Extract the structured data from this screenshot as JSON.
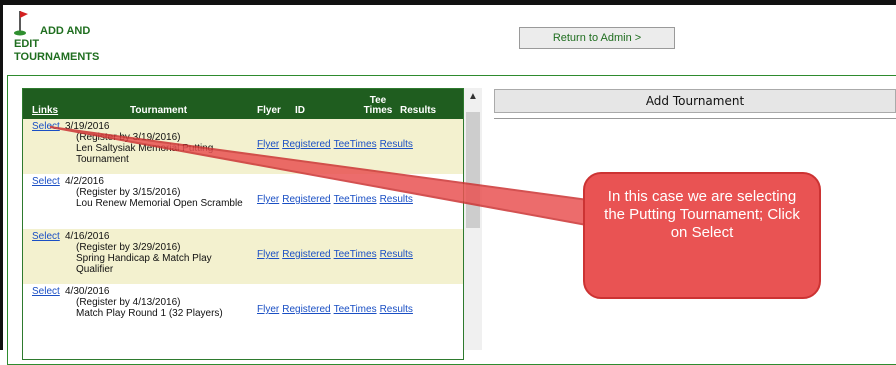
{
  "header": {
    "title_line1": "ADD AND",
    "title_line2": "EDIT",
    "title_line3": "TOURNAMENTS"
  },
  "return_button": "Return to Admin >",
  "add_button": "Add Tournament",
  "table": {
    "headers": {
      "links": "Links",
      "tournament": "Tournament",
      "flyer": "Flyer",
      "id": "ID",
      "tee_line1": "Tee",
      "tee_line2": "Times",
      "results": "Results"
    },
    "rows": [
      {
        "select": "Select",
        "date": "3/19/2016",
        "register": "(Register by 3/19/2016)",
        "name": "Len Saltysiak Memorial Putting Tournament",
        "flyer": "Flyer",
        "id": "Registered",
        "tee": "TeeTimes",
        "results": "Results"
      },
      {
        "select": "Select",
        "date": "4/2/2016",
        "register": "(Register by 3/15/2016)",
        "name": "Lou Renew Memorial Open Scramble",
        "flyer": "Flyer",
        "id": "Registered",
        "tee": "TeeTimes",
        "results": "Results"
      },
      {
        "select": "Select",
        "date": "4/16/2016",
        "register": "(Register by 3/29/2016)",
        "name": "Spring Handicap & Match Play Qualifier",
        "flyer": "Flyer",
        "id": "Registered",
        "tee": "TeeTimes",
        "results": "Results"
      },
      {
        "select": "Select",
        "date": "4/30/2016",
        "register": "(Register by 4/13/2016)",
        "name": "Match Play Round 1 (32 Players)",
        "flyer": "Flyer",
        "id": "Registered",
        "tee": "TeeTimes",
        "results": "Results"
      }
    ]
  },
  "callout": {
    "text": "In this case we are selecting the Putting Tournament; Click on Select"
  },
  "colors": {
    "brand_green": "#1f5d1f",
    "callout_red": "#e95353",
    "link_blue": "#1a4fc4"
  }
}
